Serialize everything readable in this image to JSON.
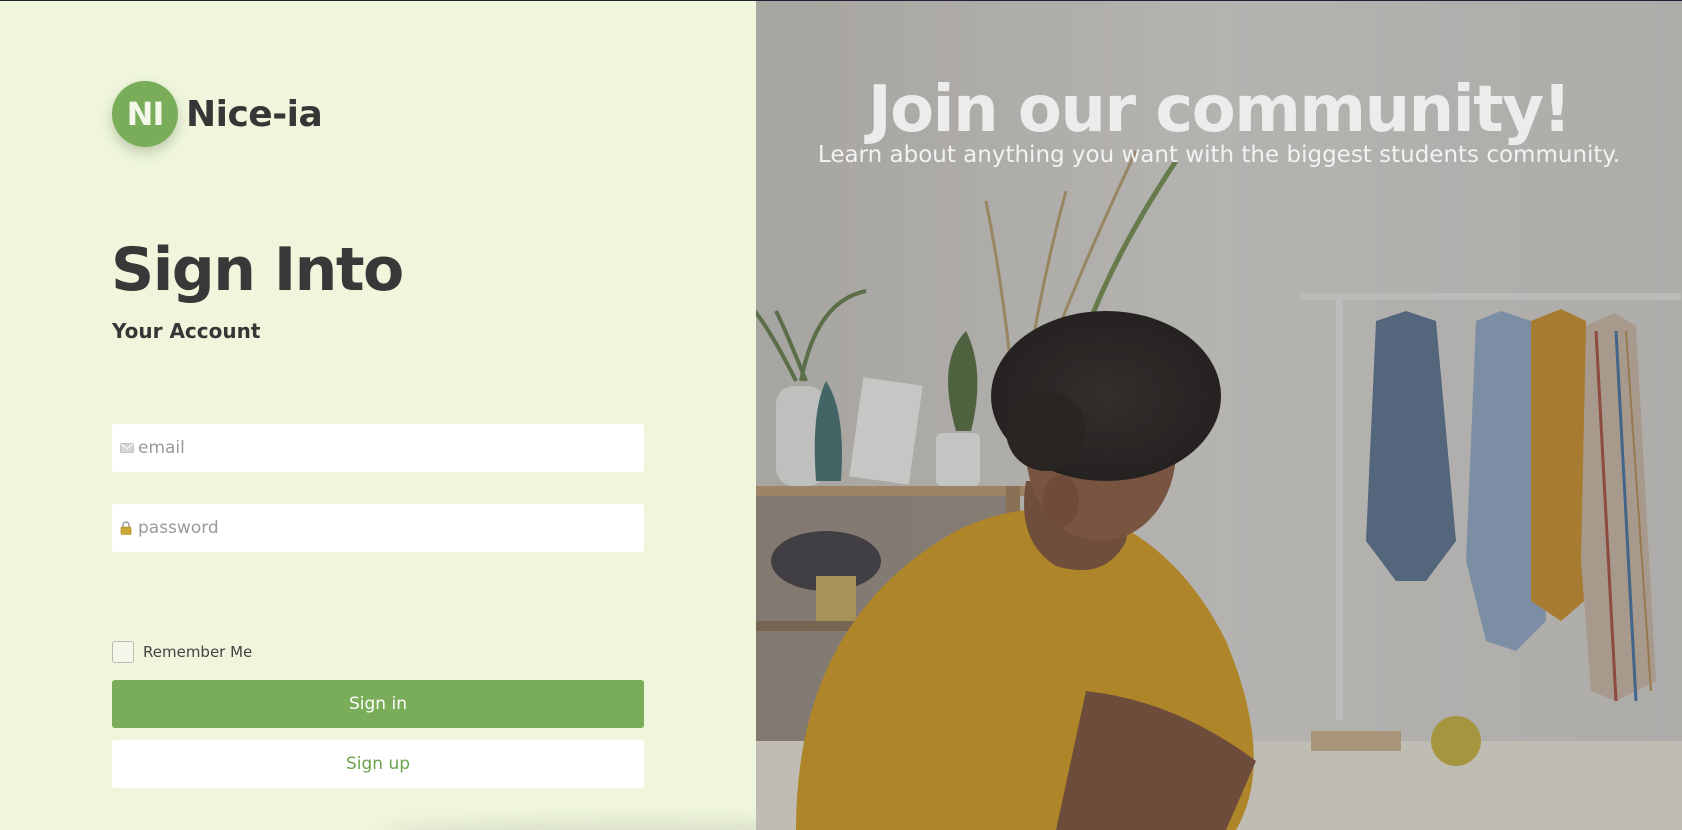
{
  "brand": {
    "initials": "NI",
    "name": "Nice-ia"
  },
  "login": {
    "title": "Sign Into",
    "subtitle": "Your Account",
    "email_placeholder": "email",
    "password_placeholder": "password",
    "remember_label": "Remember Me",
    "remember_checked": false,
    "signin_label": "Sign in",
    "signup_label": "Sign up"
  },
  "hero": {
    "title": "Join our community!",
    "subtitle": "Learn about anything you want with the biggest students community."
  },
  "colors": {
    "panel_bg": "#eff6dc",
    "accent": "#79ad59",
    "text_dark": "#383838"
  },
  "icons": {
    "email": "envelope-icon",
    "password": "lock-icon"
  }
}
